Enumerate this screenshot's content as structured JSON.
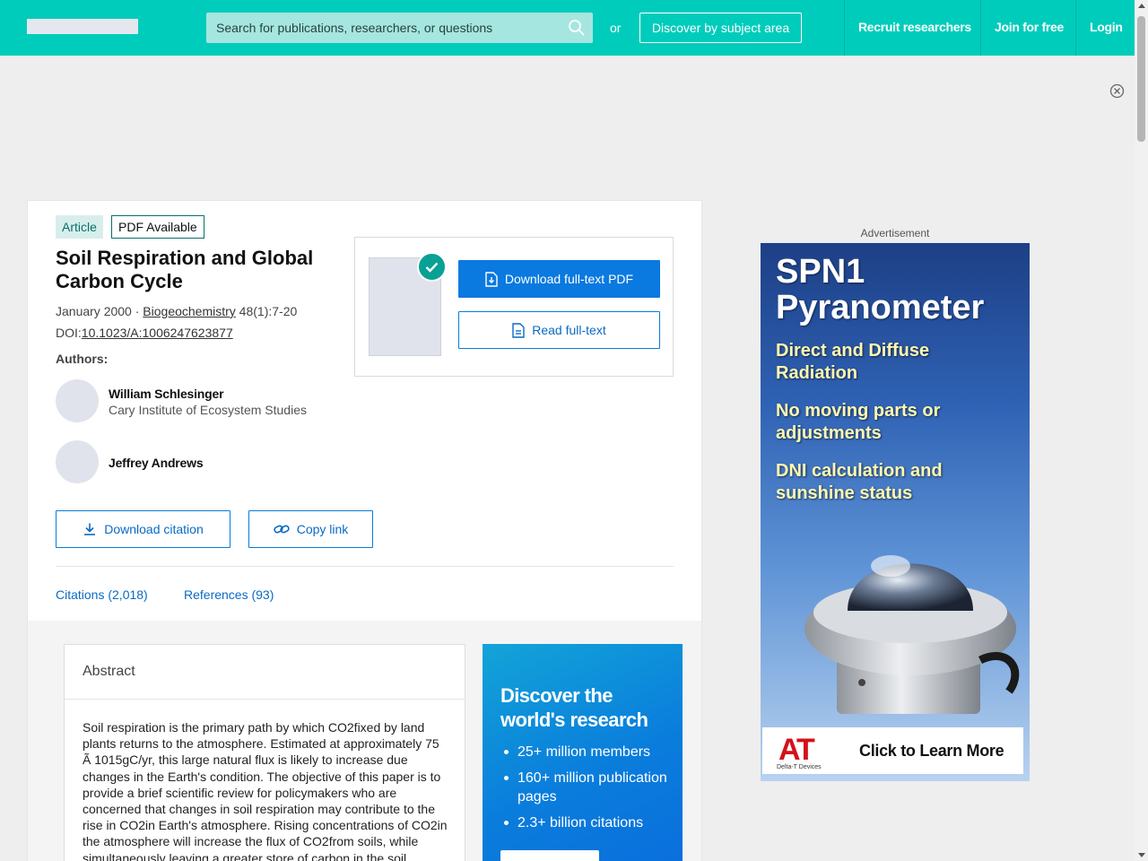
{
  "header": {
    "search_placeholder": "Search for publications, researchers, or questions",
    "or_label": "or",
    "discover_label": "Discover by subject area",
    "nav": [
      "Recruit researchers",
      "Join for free",
      "Login"
    ]
  },
  "article": {
    "badges": [
      "Article",
      "PDF Available"
    ],
    "title": "Soil Respiration and Global Carbon Cycle",
    "date": "January 2000 · ",
    "journal": "Biogeochemistry",
    "volume": " 48(1):7-20",
    "doi_label": "DOI:",
    "doi": "10.1023/A:1006247623877",
    "authors_label": "Authors:",
    "authors": [
      {
        "name": "William Schlesinger",
        "institution": "Cary Institute of Ecosystem Studies"
      },
      {
        "name": "Jeffrey Andrews",
        "institution": ""
      }
    ],
    "download_citation": "Download citation",
    "copy_link": "Copy link",
    "tabs": [
      "Citations (2,018)",
      "References (93)"
    ]
  },
  "pdf": {
    "download_label": "Download full-text PDF",
    "read_label": "Read full-text"
  },
  "abstract": {
    "title": "Abstract",
    "text": "Soil respiration is the primary path by which CO2fixed by land plants returns to the atmosphere. Estimated at approximately 75 Ã 1015gC/yr, this large natural flux is likely to increase due changes in the Earth's condition. The objective of this paper is to provide a brief scientific review for policymakers who are concerned that changes in soil respiration may contribute to the rise in CO2in Earth's atmosphere. Rising concentrations of CO2in the atmosphere will increase the flux of CO2from soils, while simultaneously leaving a greater store of carbon in the soil."
  },
  "promo": {
    "title": "Discover the world's research",
    "items": [
      "25+ million members",
      "160+ million publication pages",
      "2.3+ billion citations"
    ]
  },
  "ad": {
    "label": "Advertisement",
    "headline": "SPN1 Pyranometer",
    "lines": [
      "Direct and Diffuse Radiation",
      "No moving parts or adjustments",
      "DNI calculation and sunshine status"
    ],
    "logo": "AT",
    "logo_sub": "Delta-T Devices",
    "cta": "Click to Learn More"
  }
}
